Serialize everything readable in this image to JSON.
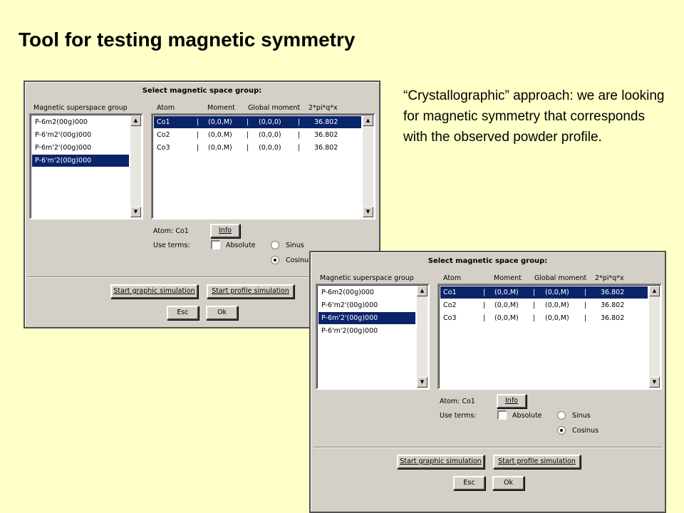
{
  "slide": {
    "title": "Tool for testing magnetic symmetry",
    "description": "“Crystallographic” approach: we are looking for magnetic symmetry that corresponds with the observed powder profile."
  },
  "dialog_1": {
    "title": "Select magnetic space group:",
    "group_list_header": "Magnetic superspace group",
    "groups": [
      "P-6m2(00g)000",
      "P-6'm2'(00g)000",
      "P-6m'2'(00g)000",
      "P-6'm'2(00g)000"
    ],
    "selected_group_index": 3,
    "atom_table_headers": [
      "Atom",
      "Moment",
      "Global moment",
      "2*pi*q*x"
    ],
    "atoms": [
      {
        "atom": "Co1",
        "sep1": "|",
        "moment": "(0,0,M)",
        "sep2": "|",
        "global": "(0,0,0)",
        "sep3": "|",
        "phase": "36.802"
      },
      {
        "atom": "Co2",
        "sep1": "|",
        "moment": "(0,0,M)",
        "sep2": "|",
        "global": "(0,0,0)",
        "sep3": "|",
        "phase": "36.802"
      },
      {
        "atom": "Co3",
        "sep1": "|",
        "moment": "(0,0,M)",
        "sep2": "|",
        "global": "(0,0,0)",
        "sep3": "|",
        "phase": "36.802"
      }
    ],
    "selected_atom_index": 0,
    "atom_label": "Atom: Co1",
    "info_button": "Info",
    "use_terms_label": "Use terms:",
    "absolute_label": "Absolute",
    "absolute_checked": false,
    "sinus_label": "Sinus",
    "cosinus_label": "Cosinus",
    "selected_term": "Cosinus",
    "start_graphic_button": "Start graphic simulation",
    "start_profile_button": "Start profile simulation",
    "esc_button": "Esc",
    "ok_button": "Ok"
  },
  "dialog_2": {
    "title": "Select magnetic space group:",
    "group_list_header": "Magnetic superspace group",
    "groups": [
      "P-6m2(00g)000",
      "P-6'm2'(00g)000",
      "P-6m'2'(00g)000",
      "P-6'm'2(00g)000"
    ],
    "selected_group_index": 2,
    "atom_table_headers": [
      "Atom",
      "Moment",
      "Global moment",
      "2*pi*q*x"
    ],
    "atoms": [
      {
        "atom": "Co1",
        "sep1": "|",
        "moment": "(0,0,M)",
        "sep2": "|",
        "global": "(0,0,M)",
        "sep3": "|",
        "phase": "36.802"
      },
      {
        "atom": "Co2",
        "sep1": "|",
        "moment": "(0,0,M)",
        "sep2": "|",
        "global": "(0,0,M)",
        "sep3": "|",
        "phase": "36.802"
      },
      {
        "atom": "Co3",
        "sep1": "|",
        "moment": "(0,0,M)",
        "sep2": "|",
        "global": "(0,0,M)",
        "sep3": "|",
        "phase": "36.802"
      }
    ],
    "selected_atom_index": 0,
    "atom_label": "Atom: Co1",
    "info_button": "Info",
    "use_terms_label": "Use terms:",
    "absolute_label": "Absolute",
    "absolute_checked": false,
    "sinus_label": "Sinus",
    "cosinus_label": "Cosinus",
    "selected_term": "Cosinus",
    "start_graphic_button": "Start graphic simulation",
    "start_profile_button": "Start profile simulation",
    "esc_button": "Esc",
    "ok_button": "Ok"
  },
  "icons": {
    "scroll_up": "scroll-up-arrow-icon",
    "scroll_down": "scroll-down-arrow-icon"
  },
  "colors": {
    "slide_background": "#ffffc8",
    "dialog_face": "#d4d0c8",
    "selection": "#0a246a"
  }
}
